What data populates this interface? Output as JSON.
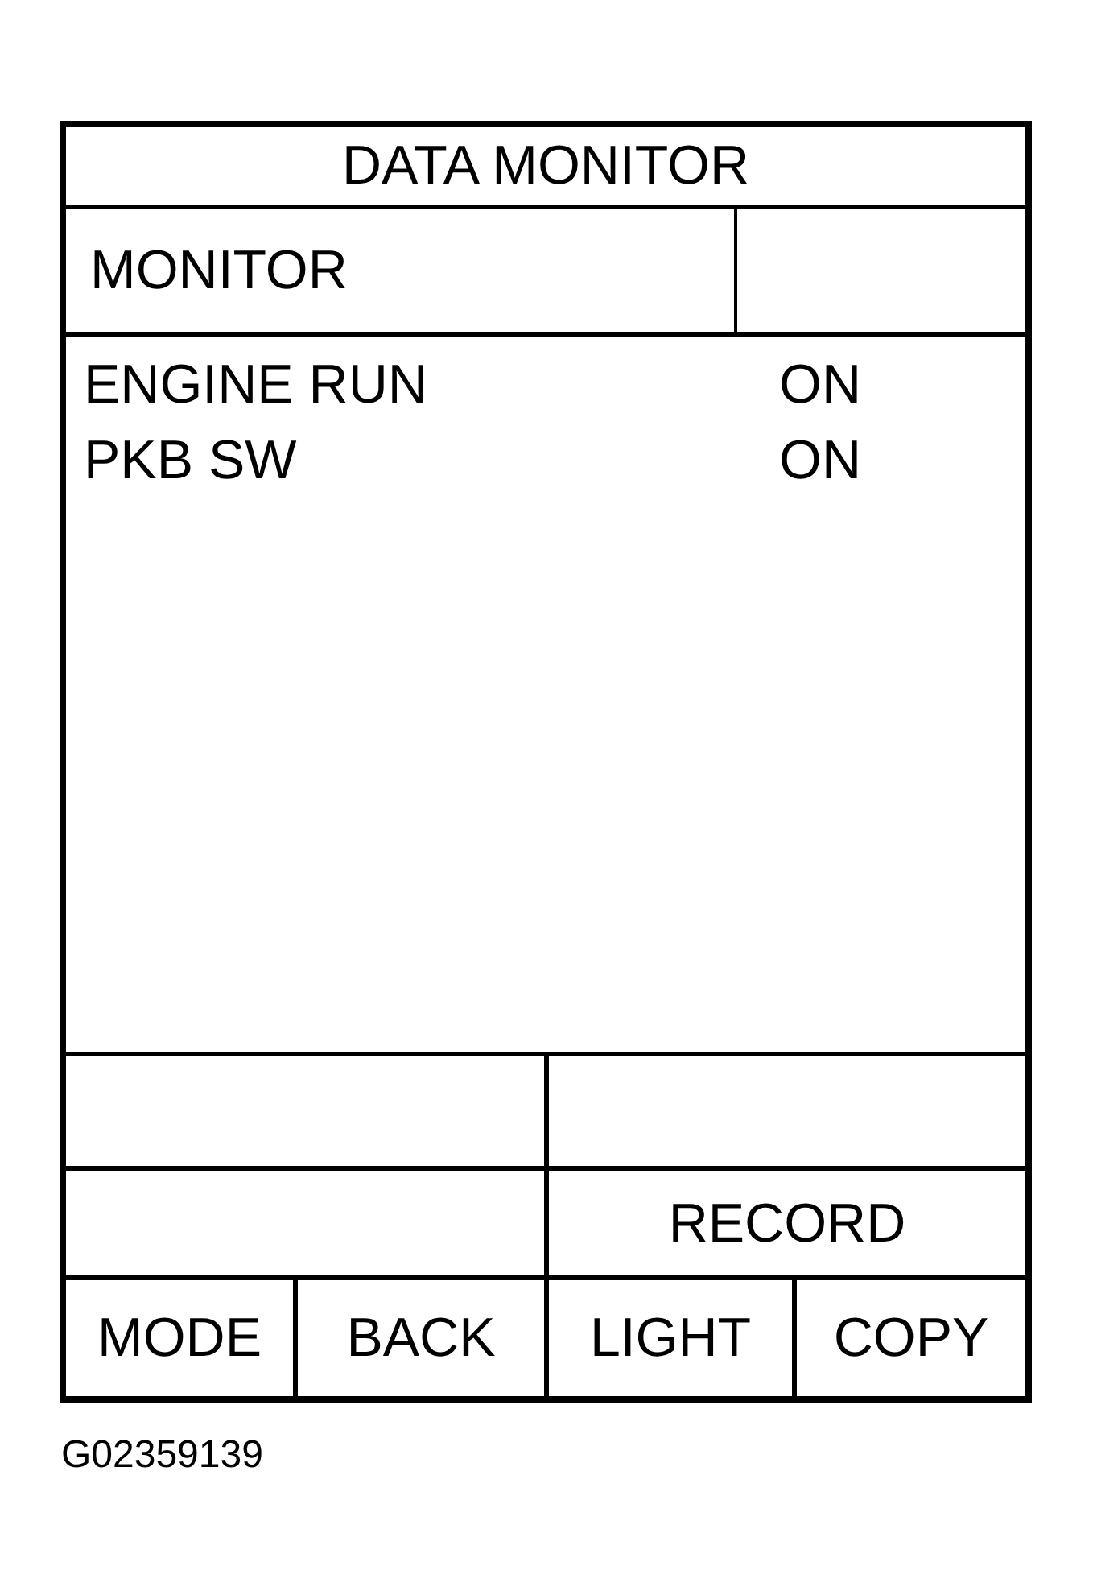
{
  "screen": {
    "title": "DATA MONITOR",
    "monitor_header": "MONITOR",
    "items": [
      {
        "name": "ENGINE RUN",
        "value": "ON"
      },
      {
        "name": "PKB SW",
        "value": "ON"
      }
    ],
    "record_button": "RECORD",
    "buttons": [
      "MODE",
      "BACK",
      "LIGHT",
      "COPY"
    ]
  },
  "figure_id": "G02359139"
}
